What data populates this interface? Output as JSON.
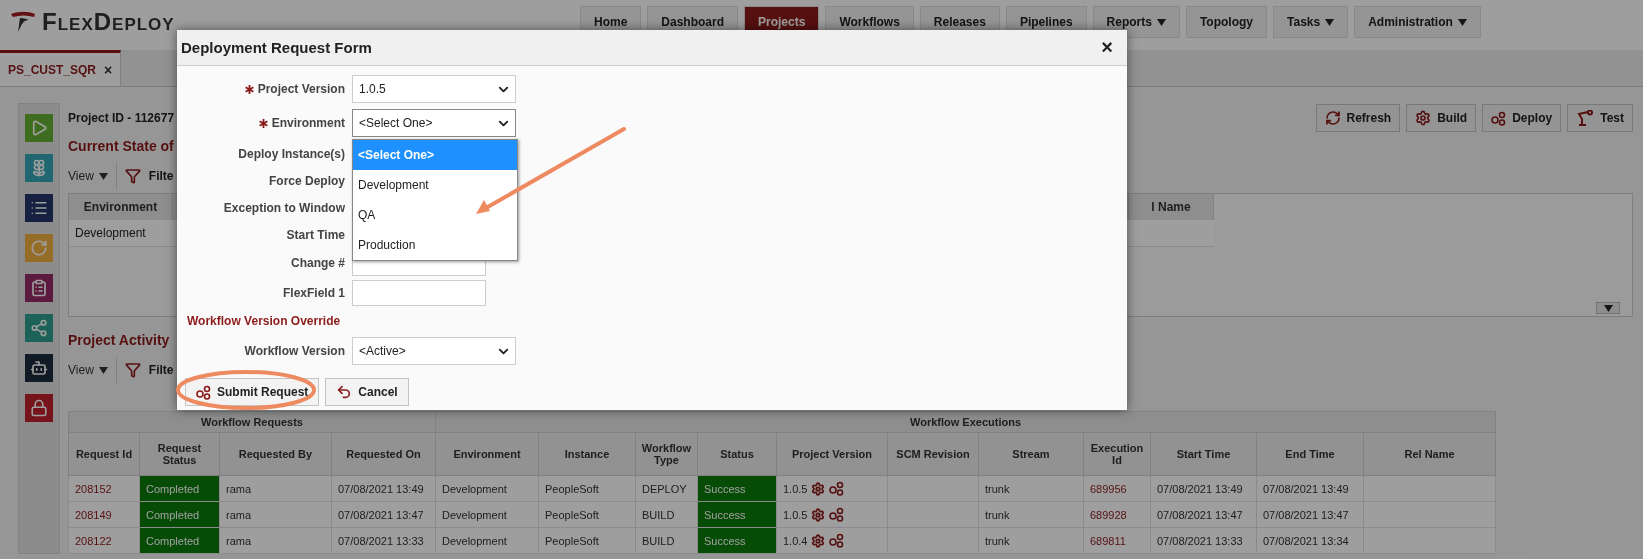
{
  "app": {
    "logo": "FlexDeploy"
  },
  "nav": [
    {
      "label": "Home",
      "selected": false,
      "dropdown": false
    },
    {
      "label": "Dashboard",
      "selected": false,
      "dropdown": false
    },
    {
      "label": "Projects",
      "selected": true,
      "dropdown": false
    },
    {
      "label": "Workflows",
      "selected": false,
      "dropdown": false
    },
    {
      "label": "Releases",
      "selected": false,
      "dropdown": false
    },
    {
      "label": "Pipelines",
      "selected": false,
      "dropdown": false
    },
    {
      "label": "Reports",
      "selected": false,
      "dropdown": true
    },
    {
      "label": "Topology",
      "selected": false,
      "dropdown": false
    },
    {
      "label": "Tasks",
      "selected": false,
      "dropdown": true
    },
    {
      "label": "Administration",
      "selected": false,
      "dropdown": true
    }
  ],
  "doc_tabs": [
    {
      "label": "PS_CUST_SQR",
      "close": "×",
      "selected": true
    }
  ],
  "sidebar": [
    {
      "kind": "play"
    },
    {
      "kind": "flower"
    },
    {
      "kind": "list"
    },
    {
      "kind": "cycle"
    },
    {
      "kind": "report"
    },
    {
      "kind": "network"
    },
    {
      "kind": "robot"
    },
    {
      "kind": "lock"
    }
  ],
  "project": {
    "title": "Project ID - 112677",
    "actions": [
      {
        "label": "Refresh",
        "kind": "refresh"
      },
      {
        "label": "Build",
        "kind": "build"
      },
      {
        "label": "Deploy",
        "kind": "deploy"
      },
      {
        "label": "Test",
        "kind": "test"
      }
    ]
  },
  "current_state": {
    "heading": "Current State of",
    "toolbar": {
      "view": "View",
      "filter": "Filte"
    },
    "columns": [
      "Environment",
      "l Name"
    ],
    "rows": [
      {
        "environment": "Development"
      }
    ]
  },
  "activity": {
    "heading": "Project Activity",
    "toolbar": {
      "view": "View",
      "filter": "Filte"
    },
    "groups": [
      {
        "label": "Workflow Requests",
        "columns": [
          "Request Id",
          "Request Status",
          "Requested By",
          "Requested On"
        ]
      },
      {
        "label": "Workflow Executions",
        "columns": [
          "Environment",
          "Instance",
          "Workflow Type",
          "Status",
          "Project Version",
          "SCM Revision",
          "Stream",
          "Execution Id",
          "Start Time",
          "End Time",
          "Rel Name"
        ]
      }
    ],
    "rows": [
      {
        "request_id": "208152",
        "request_status": "Completed",
        "requested_by": "rama",
        "requested_on": "07/08/2021 13:49",
        "environment": "Development",
        "instance": "PeopleSoft",
        "workflow_type": "DEPLOY",
        "status": "Success",
        "project_version": "1.0.5",
        "stream": "trunk",
        "execution_id": "689956",
        "start_time": "07/08/2021 13:49",
        "end_time": "07/08/2021 13:49"
      },
      {
        "request_id": "208149",
        "request_status": "Completed",
        "requested_by": "rama",
        "requested_on": "07/08/2021 13:47",
        "environment": "Development",
        "instance": "PeopleSoft",
        "workflow_type": "BUILD",
        "status": "Success",
        "project_version": "1.0.5",
        "stream": "trunk",
        "execution_id": "689928",
        "start_time": "07/08/2021 13:47",
        "end_time": "07/08/2021 13:47"
      },
      {
        "request_id": "208122",
        "request_status": "Completed",
        "requested_by": "rama",
        "requested_on": "07/08/2021 13:33",
        "environment": "Development",
        "instance": "PeopleSoft",
        "workflow_type": "BUILD",
        "status": "Success",
        "project_version": "1.0.4",
        "stream": "trunk",
        "execution_id": "689811",
        "start_time": "07/08/2021 13:33",
        "end_time": "07/08/2021 13:34"
      }
    ]
  },
  "dialog": {
    "title": "Deployment Request Form",
    "close": "×",
    "fields": [
      {
        "kind": "select",
        "label": "Project Version",
        "required": true,
        "value": "1.0.5",
        "expanded": false
      },
      {
        "kind": "select",
        "label": "Environment",
        "required": true,
        "value": "<Select One>",
        "expanded": true,
        "options": [
          {
            "label": "<Select One>",
            "selected": true
          },
          {
            "label": "Development",
            "selected": false
          },
          {
            "label": "QA",
            "selected": false
          },
          {
            "label": "Production",
            "selected": false
          }
        ]
      },
      {
        "kind": "label",
        "label": "Deploy Instance(s)",
        "required": false
      },
      {
        "kind": "label",
        "label": "Force Deploy",
        "required": false
      },
      {
        "kind": "label",
        "label": "Exception to Window",
        "required": false
      },
      {
        "kind": "label",
        "label": "Start Time",
        "required": false
      },
      {
        "kind": "text",
        "label": "Change #",
        "required": false
      },
      {
        "kind": "text",
        "label": "FlexField 1",
        "required": false
      },
      {
        "kind": "section",
        "label": "Workflow Version Override"
      },
      {
        "kind": "select",
        "label": "Workflow Version",
        "required": false,
        "value": "<Active>",
        "expanded": false
      }
    ],
    "buttons": [
      {
        "label": "Submit Request",
        "kind": "submit"
      },
      {
        "label": "Cancel",
        "kind": "cancel"
      }
    ]
  }
}
